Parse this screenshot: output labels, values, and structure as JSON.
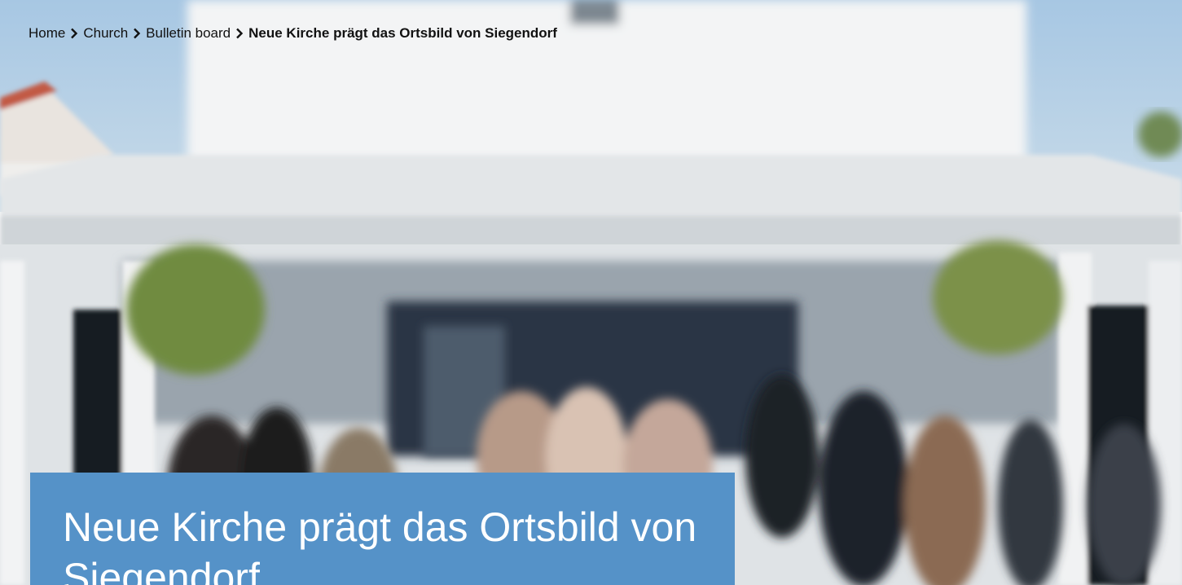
{
  "breadcrumb": {
    "items": [
      {
        "label": "Home"
      },
      {
        "label": "Church"
      },
      {
        "label": "Bulletin board"
      }
    ],
    "current": "Neue Kirche prägt das Ortsbild von Siegendorf",
    "separator_icon": "chevron-right-icon"
  },
  "article": {
    "title": "Neue Kirche prägt das Ortsbild von Siegendorf"
  },
  "colors": {
    "title_card_bg": "#5592c8",
    "sky": "#aacbe6",
    "building_white": "#eef0f1",
    "text_dark": "#111111"
  }
}
